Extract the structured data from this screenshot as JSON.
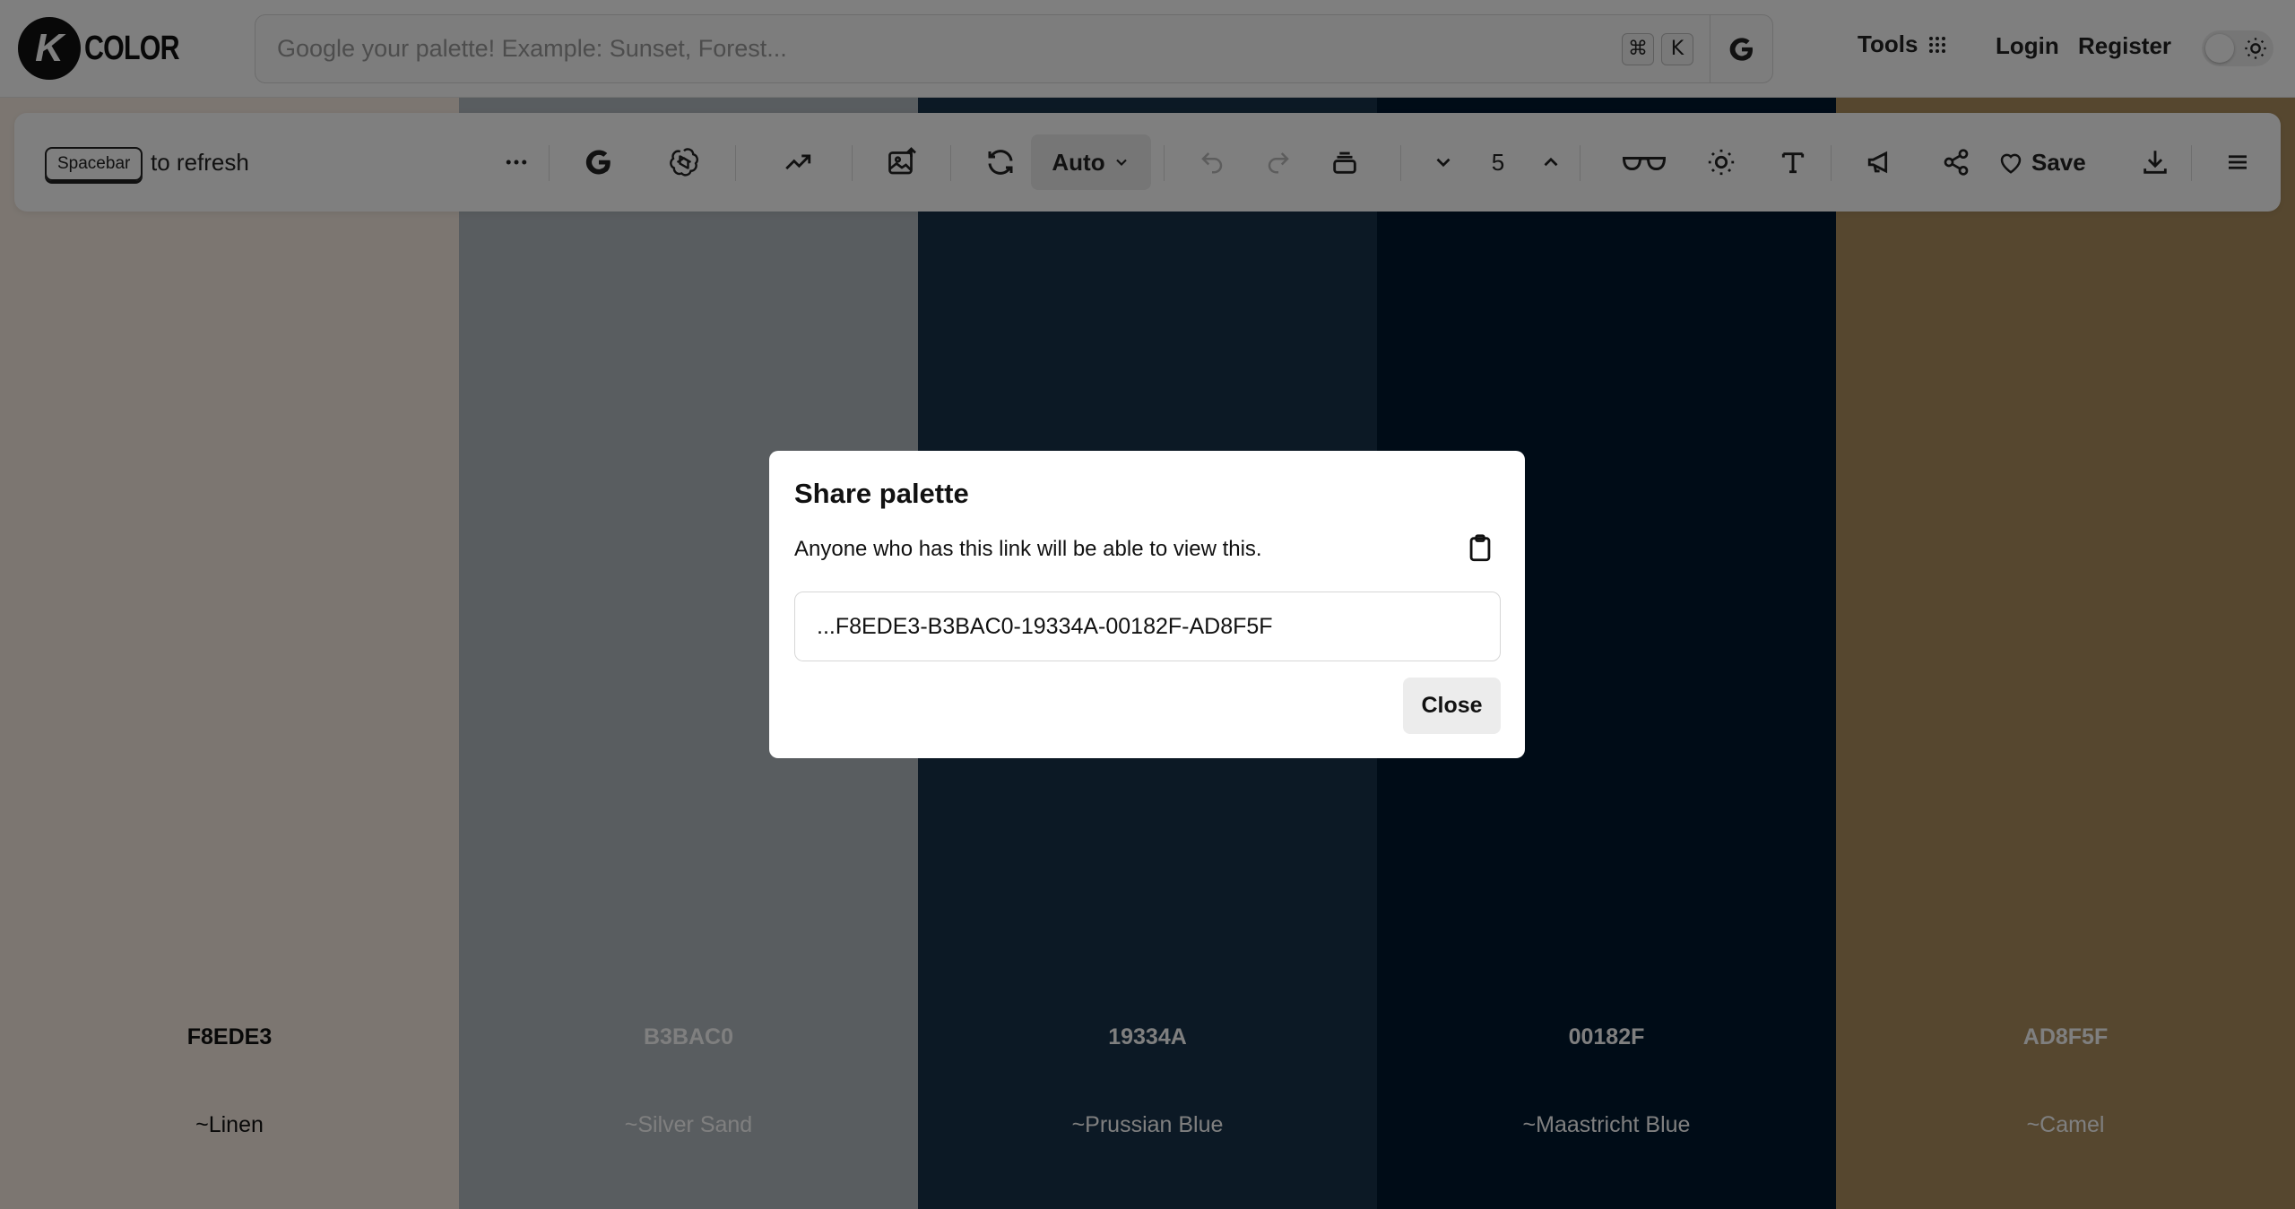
{
  "header": {
    "logo_letter": "K",
    "logo_text": "COLOR",
    "search_placeholder": "Google your palette! Example: Sunset, Forest...",
    "kbd_cmd": "⌘",
    "kbd_k": "K",
    "tools_label": "Tools",
    "login_label": "Login",
    "register_label": "Register"
  },
  "toolbar": {
    "spacebar_key": "Spacebar",
    "refresh_text": "to refresh",
    "auto_label": "Auto",
    "count": "5",
    "save_label": "Save"
  },
  "palette": [
    {
      "hex": "F8EDE3",
      "name": "~Linen",
      "color": "#F8EDE3",
      "text_color": "#111111"
    },
    {
      "hex": "B3BAC0",
      "name": "~Silver Sand",
      "color": "#B3BAC0",
      "text_color": "#ffffff"
    },
    {
      "hex": "19334A",
      "name": "~Prussian Blue",
      "color": "#19334A",
      "text_color": "#ffffff"
    },
    {
      "hex": "00182F",
      "name": "~Maastricht Blue",
      "color": "#00182F",
      "text_color": "#ffffff"
    },
    {
      "hex": "AD8F5F",
      "name": "~Camel",
      "color": "#AD8F5F",
      "text_color": "#ffffff"
    }
  ],
  "modal": {
    "title": "Share palette",
    "description": "Anyone who has this link will be able to view this.",
    "link": "...F8EDE3-B3BAC0-19334A-00182F-AD8F5F",
    "close_label": "Close"
  }
}
